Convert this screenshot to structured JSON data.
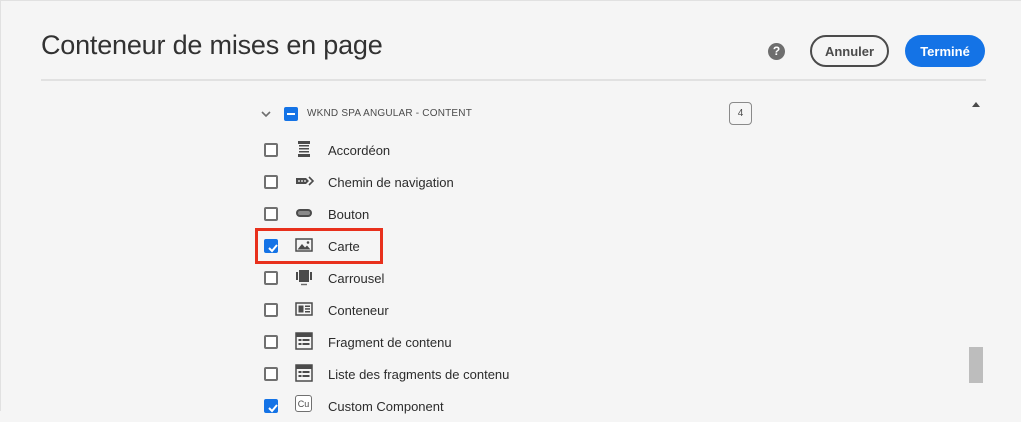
{
  "dialog": {
    "title": "Conteneur de mises en page",
    "help_glyph": "?",
    "cancel_label": "Annuler",
    "done_label": "Terminé"
  },
  "group": {
    "label": "WKND SPA ANGULAR - CONTENT",
    "count": "4",
    "expanded": true,
    "state": "partial"
  },
  "components": [
    {
      "label": "Accordéon",
      "checked": false,
      "icon": "accordion-icon"
    },
    {
      "label": "Chemin de navigation",
      "checked": false,
      "icon": "breadcrumb-icon"
    },
    {
      "label": "Bouton",
      "checked": false,
      "icon": "button-icon"
    },
    {
      "label": "Carte",
      "checked": true,
      "icon": "image-icon"
    },
    {
      "label": "Carrousel",
      "checked": false,
      "icon": "carousel-icon"
    },
    {
      "label": "Conteneur",
      "checked": false,
      "icon": "container-icon"
    },
    {
      "label": "Fragment de contenu",
      "checked": false,
      "icon": "content-fragment-icon"
    },
    {
      "label": "Liste des fragments de contenu",
      "checked": false,
      "icon": "content-fragment-list-icon"
    },
    {
      "label": "Custom Component",
      "checked": true,
      "icon": "custom-component-icon",
      "icon_text": "Cu"
    }
  ],
  "colors": {
    "accent": "#1473e6",
    "highlight": "#e8301c"
  }
}
